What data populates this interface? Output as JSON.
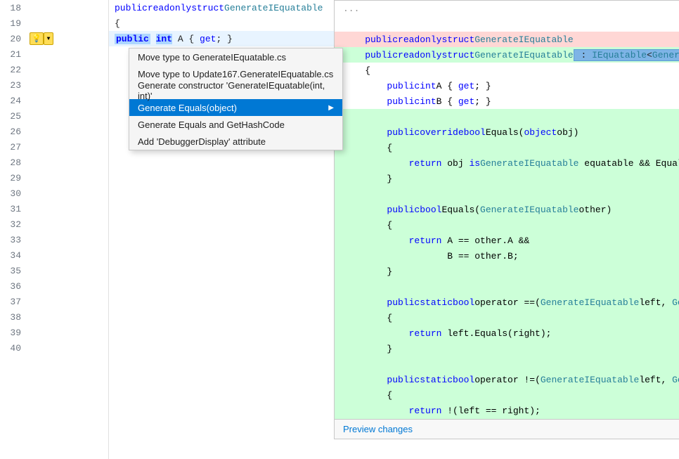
{
  "colors": {
    "keyword": "#0000ff",
    "type_color": "#267f99",
    "text": "#1e1e1e",
    "removed_bg": "#ffd7d5",
    "added_bg": "#d4e8c2",
    "menu_selected_bg": "#0078d4",
    "accent": "#0078d4"
  },
  "line_numbers": [
    18,
    19,
    20,
    21,
    22,
    23,
    24,
    25,
    26,
    27,
    28,
    29,
    30,
    31,
    32,
    33,
    34,
    35,
    36,
    37,
    38,
    39,
    40
  ],
  "menu": {
    "items": [
      {
        "label": "Move type to GenerateIEquatable.cs",
        "has_arrow": false
      },
      {
        "label": "Move type to Update167.GenerateIEquatable.cs",
        "has_arrow": false
      },
      {
        "label": "Generate constructor 'GenerateIEquatable(int, int)'",
        "has_arrow": false
      },
      {
        "label": "Generate Equals(object)",
        "has_arrow": true,
        "selected": true
      },
      {
        "label": "Generate Equals and GetHashCode",
        "has_arrow": false
      },
      {
        "label": "Add 'DebuggerDisplay' attribute",
        "has_arrow": false
      }
    ]
  },
  "preview_link": "Preview changes",
  "diff_lines": [
    {
      "text": "...",
      "type": "normal"
    },
    {
      "text": "",
      "type": "normal"
    },
    {
      "text": "    public readonly struct GenerateIEquatable",
      "type": "removed"
    },
    {
      "text": "    public readonly struct GenerateIEquatable : IEquatable<GenerateIEquatable>",
      "type": "added"
    },
    {
      "text": "    {",
      "type": "normal"
    },
    {
      "text": "        public int A { get; }",
      "type": "normal"
    },
    {
      "text": "        public int B { get; }",
      "type": "normal"
    },
    {
      "text": "",
      "type": "normal"
    },
    {
      "text": "        public override bool Equals(object obj)",
      "type": "added"
    },
    {
      "text": "        {",
      "type": "added"
    },
    {
      "text": "            return obj is GenerateIEquatable equatable && Equals(equatable);",
      "type": "added"
    },
    {
      "text": "        }",
      "type": "added"
    },
    {
      "text": "",
      "type": "added"
    },
    {
      "text": "        public bool Equals(GenerateIEquatable other)",
      "type": "added"
    },
    {
      "text": "        {",
      "type": "added"
    },
    {
      "text": "            return A == other.A &&",
      "type": "added"
    },
    {
      "text": "                   B == other.B;",
      "type": "added"
    },
    {
      "text": "        }",
      "type": "added"
    },
    {
      "text": "",
      "type": "added"
    },
    {
      "text": "        public static bool operator ==(GenerateIEquatable left, GenerateIEquatable right)",
      "type": "added"
    },
    {
      "text": "        {",
      "type": "added"
    },
    {
      "text": "            return left.Equals(right);",
      "type": "added"
    },
    {
      "text": "        }",
      "type": "added"
    },
    {
      "text": "",
      "type": "added"
    },
    {
      "text": "        public static bool operator !=(GenerateIEquatable left, GenerateIEquatable right)",
      "type": "added"
    },
    {
      "text": "        {",
      "type": "added"
    },
    {
      "text": "            return !(left == right);",
      "type": "added"
    },
    {
      "text": "        }",
      "type": "added"
    },
    {
      "text": "    }",
      "type": "normal"
    },
    {
      "text": "...",
      "type": "normal"
    }
  ]
}
